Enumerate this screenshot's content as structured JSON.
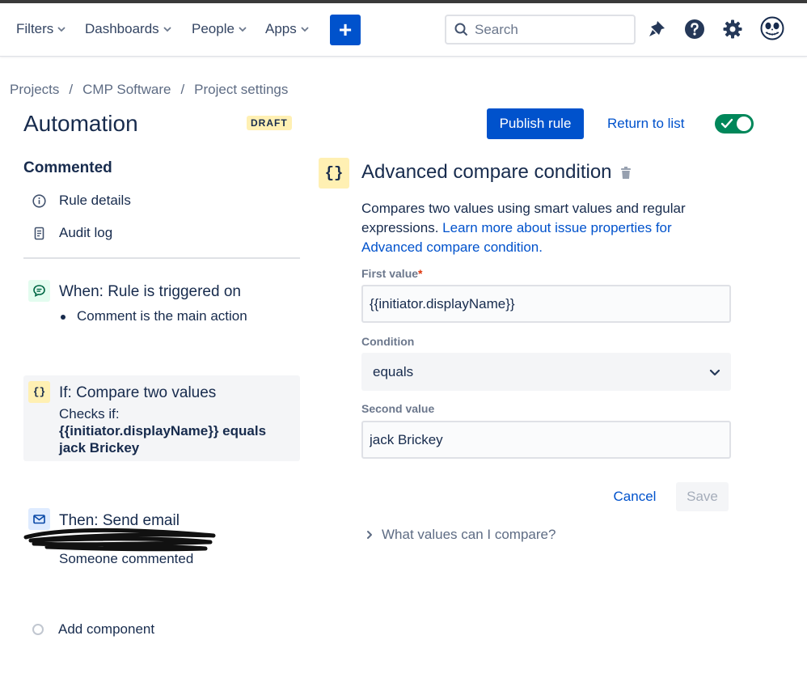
{
  "nav": {
    "items": [
      {
        "label": "Filters"
      },
      {
        "label": "Dashboards"
      },
      {
        "label": "People"
      },
      {
        "label": "Apps"
      }
    ],
    "create_label": "+",
    "search_placeholder": "Search"
  },
  "breadcrumb": [
    "Projects",
    "CMP Software",
    "Project settings"
  ],
  "breadcrumb_sep": "/",
  "header": {
    "title": "Automation",
    "badge": "DRAFT",
    "publish_label": "Publish rule",
    "return_label": "Return to list",
    "enabled": true
  },
  "sidebar": {
    "rule_name": "Commented",
    "links": [
      {
        "label": "Rule details",
        "icon": "info-icon"
      },
      {
        "label": "Audit log",
        "icon": "document-icon"
      }
    ],
    "components": {
      "trigger": {
        "title": "When: Rule is triggered on",
        "detail": "Comment is the main action",
        "icon": "comment-icon"
      },
      "condition": {
        "title": "If: Compare two values",
        "line1": "Checks if:",
        "line2": "{{initiator.displayName}} equals",
        "line3": "jack Brickey",
        "icon": "braces-icon",
        "icon_text": "{}"
      },
      "action": {
        "title": "Then: Send email",
        "detail": "Someone commented",
        "icon": "mail-icon"
      }
    },
    "add_component": "Add component"
  },
  "panel": {
    "icon_text": "{}",
    "title": "Advanced compare condition",
    "desc_plain": "Compares two values using smart values and regular expressions. ",
    "desc_link": "Learn more about issue properties for Advanced compare condition.",
    "first_label": "First value",
    "required_mark": "*",
    "first_value": "{{initiator.displayName}}",
    "condition_label": "Condition",
    "condition_value": "equals",
    "second_label": "Second value",
    "second_value": "jack Brickey",
    "cancel_label": "Cancel",
    "save_label": "Save",
    "expander_label": "What values can I compare?"
  },
  "colors": {
    "brand": "#0052cc",
    "toggle_on": "#00875a",
    "badge_bg": "#fff0b3",
    "required": "#de350b"
  }
}
